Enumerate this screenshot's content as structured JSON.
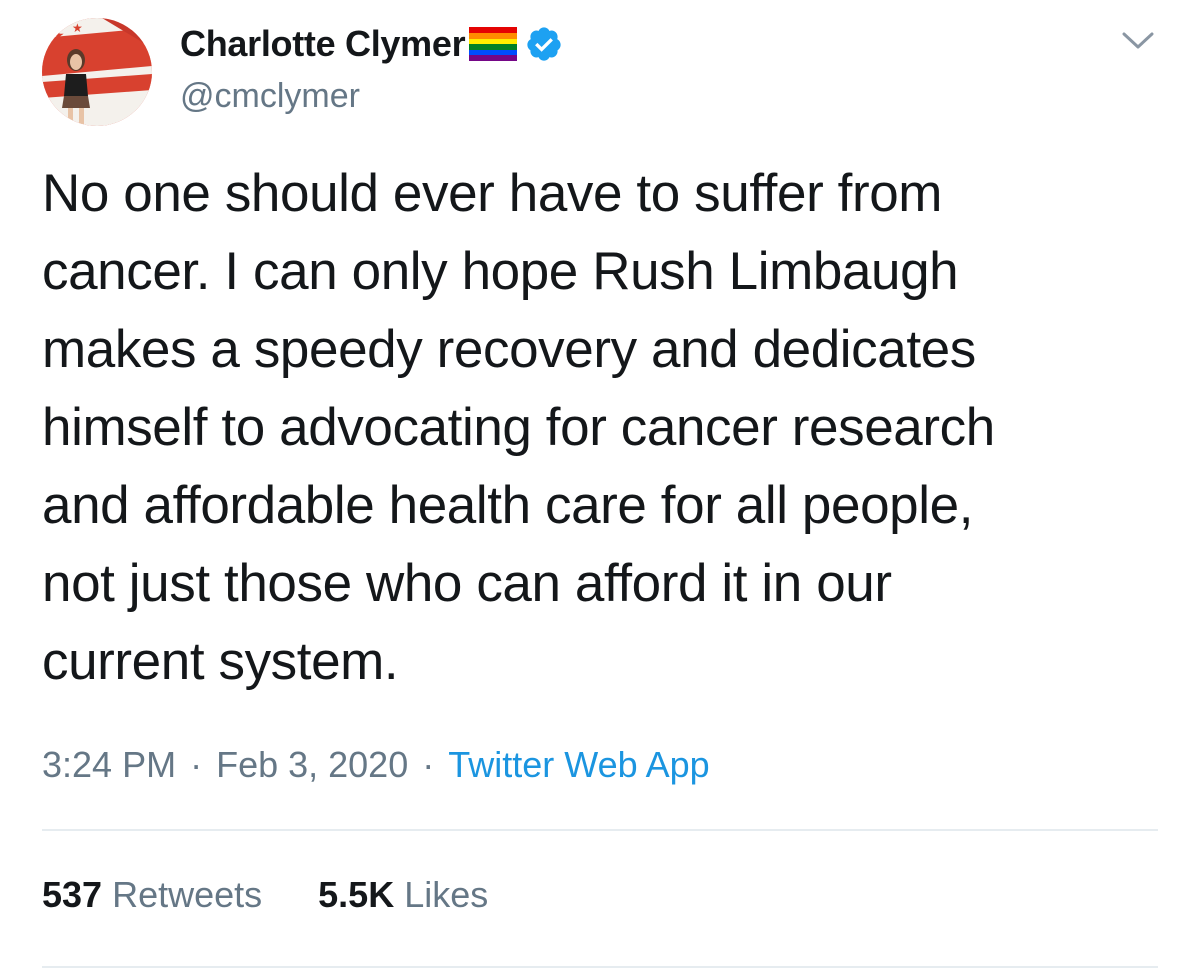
{
  "author": {
    "display_name": "Charlotte Clymer",
    "handle": "@cmclymer",
    "avatar_icon": "profile-photo",
    "flag_icon": "rainbow-flag",
    "verified_icon": "verified-badge",
    "verified_color": "#1da1f2"
  },
  "menu": {
    "caret_icon": "chevron-down-icon"
  },
  "tweet": {
    "lines": [
      "No one should ever have to suffer from",
      "cancer. I can only hope Rush Limbaugh",
      "makes a speedy recovery and dedicates",
      "himself to advocating for cancer research",
      "and affordable health care for all people,",
      "not just those who can afford it in our",
      "current system."
    ]
  },
  "meta": {
    "time": "3:24 PM",
    "separator": "·",
    "date": "Feb 3, 2020",
    "source": "Twitter Web App"
  },
  "stats": {
    "retweets_count": "537",
    "retweets_label": "Retweets",
    "likes_count": "5.5K",
    "likes_label": "Likes"
  },
  "colors": {
    "text": "#14171a",
    "secondary": "#657786",
    "link": "#1b95e0",
    "divider": "#e6ecf0"
  }
}
